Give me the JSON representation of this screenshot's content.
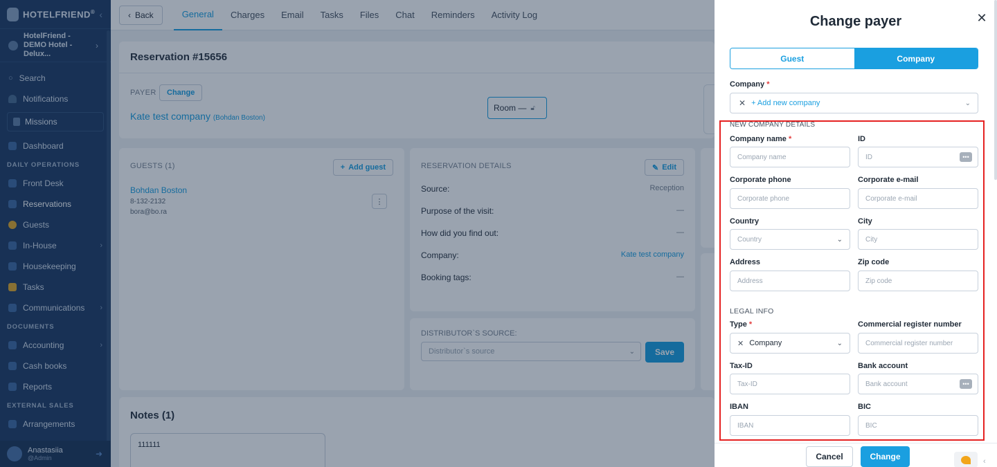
{
  "sidebar": {
    "brand": "HOTELFRIEND",
    "brand_mark": "®",
    "hotel": "HotelFriend - DEMO Hotel - Delux...",
    "search": "Search",
    "notifications": "Notifications",
    "missions": "Missions",
    "dashboard": "Dashboard",
    "section_daily": "DAILY OPERATIONS",
    "front_desk": "Front Desk",
    "reservations": "Reservations",
    "guests": "Guests",
    "in_house": "In-House",
    "housekeeping": "Housekeeping",
    "tasks": "Tasks",
    "communications": "Communications",
    "section_documents": "DOCUMENTS",
    "accounting": "Accounting",
    "cash_books": "Cash books",
    "reports": "Reports",
    "section_external": "EXTERNAL SALES",
    "arrangements": "Arrangements",
    "user_name": "Anastasiia",
    "user_role": "@Admin"
  },
  "topbar": {
    "back": "Back",
    "tabs": [
      "General",
      "Charges",
      "Email",
      "Tasks",
      "Files",
      "Chat",
      "Reminders",
      "Activity Log"
    ]
  },
  "reservation": {
    "title": "Reservation #15656",
    "payer_label": "PAYER",
    "change_label": "Change",
    "payer_name": "Kate test company",
    "payer_sub": "(Bohdan Boston)",
    "room": "Room —"
  },
  "guests": {
    "title": "GUESTS (1)",
    "add_guest": "Add guest",
    "name": "Bohdan Boston",
    "phone": "8-132-2132",
    "email": "bora@bo.ra"
  },
  "details": {
    "title": "RESERVATION DETAILS",
    "edit": "Edit",
    "rows": [
      {
        "k": "Source:",
        "v": "Reception"
      },
      {
        "k": "Purpose of the visit:",
        "v": "—"
      },
      {
        "k": "How did you find out:",
        "v": "—"
      },
      {
        "k": "Company:",
        "v": "Kate test company"
      },
      {
        "k": "Booking tags:",
        "v": "—"
      }
    ]
  },
  "distributor": {
    "title": "DISTRIBUTOR`S SOURCE:",
    "placeholder": "Distributor`s source",
    "save": "Save"
  },
  "notes": {
    "title": "Notes (1)",
    "note": "111111"
  },
  "drawer": {
    "title": "Change payer",
    "tab_guest": "Guest",
    "tab_company": "Company",
    "company_label": "Company",
    "company_value": "+ Add new company",
    "new_company_details": "NEW COMPANY DETAILS",
    "company_name_label": "Company name",
    "company_name_ph": "Company name",
    "id_label": "ID",
    "id_ph": "ID",
    "corp_phone_label": "Corporate phone",
    "corp_phone_ph": "Corporate phone",
    "corp_email_label": "Corporate e-mail",
    "corp_email_ph": "Corporate e-mail",
    "country_label": "Country",
    "country_ph": "Country",
    "city_label": "City",
    "city_ph": "City",
    "address_label": "Address",
    "address_ph": "Address",
    "zip_label": "Zip code",
    "zip_ph": "Zip code",
    "legal_info": "LEGAL INFO",
    "type_label": "Type",
    "type_value": "Company",
    "crn_label": "Commercial register number",
    "crn_ph": "Commercial register number",
    "tax_label": "Tax-ID",
    "tax_ph": "Tax-ID",
    "bank_label": "Bank account",
    "bank_ph": "Bank account",
    "iban_label": "IBAN",
    "iban_ph": "IBAN",
    "bic_label": "BIC",
    "bic_ph": "BIC",
    "cancel": "Cancel",
    "change": "Change"
  },
  "colors": {
    "accent": "#1a9fe0",
    "sidebar": "#1f3c64",
    "highlight": "#e52121",
    "required": "#e23b3b"
  },
  "icons": [
    "logo-icon",
    "search-icon",
    "bell-icon",
    "flag-icon",
    "dashboard-icon",
    "front-desk-icon",
    "reservations-icon",
    "guests-icon",
    "in-house-icon",
    "housekeeping-icon",
    "tasks-icon",
    "communications-icon",
    "accounting-icon",
    "cash-books-icon",
    "reports-icon",
    "arrangements-icon",
    "close-icon",
    "chevron-down-icon",
    "more-dots-icon",
    "lock-icon",
    "pencil-icon",
    "plus-icon",
    "chat-widget-icon"
  ]
}
